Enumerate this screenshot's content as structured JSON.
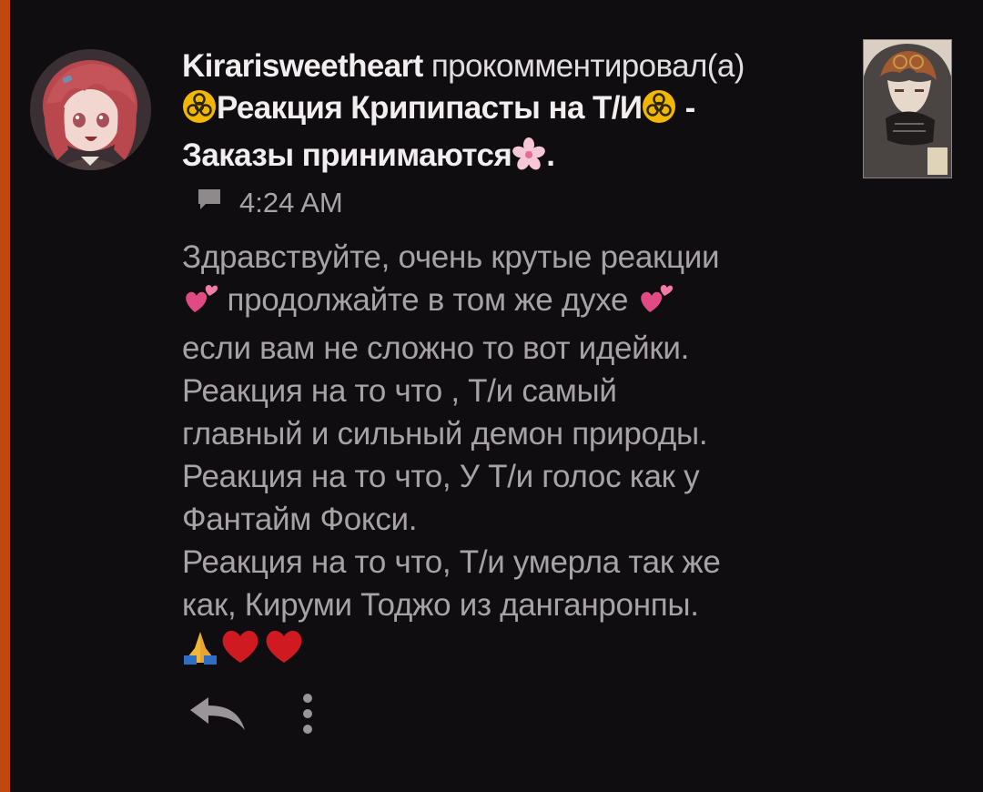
{
  "comment": {
    "username": "Kirarisweetheart",
    "action_text": "прокомментировал(а)",
    "post_title_part1": "Реакция Крипипасты на Т/И",
    "post_title_dash": "-",
    "post_title_part2": "Заказы принимаются",
    "post_title_end": ".",
    "time": "4:24 AM",
    "body_lines": [
      "Здравствуйте, очень крутые реакции",
      "продолжайте в том же духе",
      "если вам не сложно то вот идейки.",
      "Реакция на то что , Т/и самый",
      "главный и сильный демон природы.",
      "Реакция на то что, У Т/и голос как у",
      "Фантайм Фокси.",
      "Реакция на то что, Т/и умерла так же",
      "как, Кируми Тоджо из данганронпы."
    ]
  },
  "icons": {
    "biohazard": "biohazard-icon",
    "sakura": "cherry-blossom-icon",
    "hearts": "two-hearts-icon",
    "pray": "folded-hands-icon",
    "heart": "red-heart-icon",
    "chat": "comment-bubble-icon",
    "reply": "reply-arrow-icon",
    "more": "more-vertical-icon"
  },
  "colors": {
    "accent_bar": "#c0470f",
    "background": "#0f0d0f",
    "heart_pink": "#e24a86",
    "heart_red": "#d01a22",
    "biohazard_yellow": "#f2b705"
  }
}
